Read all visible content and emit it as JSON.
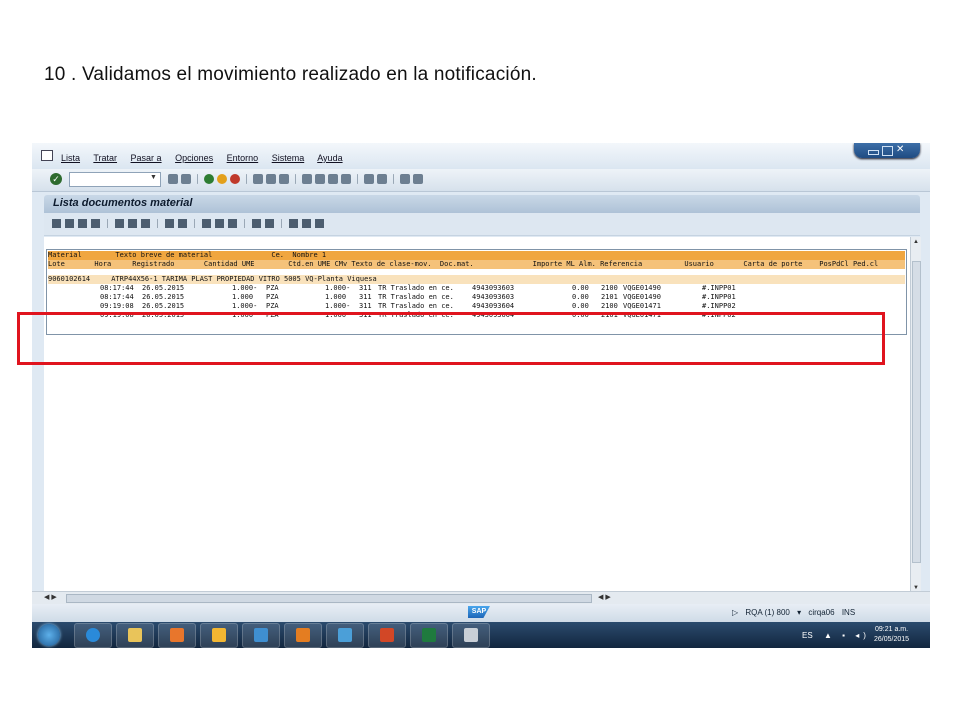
{
  "caption": "10 . Validamos el movimiento realizado en la notificación.",
  "menu": [
    "Lista",
    "Tratar",
    "Pasar a",
    "Opciones",
    "Entorno",
    "Sistema",
    "Ayuda"
  ],
  "window_title": "Lista documentos material",
  "list": {
    "header1": "Material        Texto breve de material              Ce.  Nombre 1",
    "header2": "Lote       Hora     Registrado       Cantidad UME        Ctd.en UME CMv Texto de clase-mov.  Doc.mat.              Importe ML Alm. Referencia          Usuario       Carta de porte    PosPdCl Ped.cl",
    "material_row": "9060102614     ATRP44X56-1 TARIMA PLAST PROPIEDAD VITRO 5005 VQ-Planta Viquesa",
    "rows": [
      {
        "hora": "08:17:44",
        "fecha": "26.05.2015",
        "cant": "1.000-",
        "ume": "PZA",
        "ctd": "1.000-",
        "cmv": "311",
        "texto": "TR Traslado en ce.",
        "doc": "4943093603",
        "importe": "0.00",
        "alm": "2100",
        "ref": "VQGE01490",
        "usuario": "#.INPP01",
        "neg": true
      },
      {
        "hora": "08:17:44",
        "fecha": "26.05.2015",
        "cant": "1.000",
        "ume": "PZA",
        "ctd": "1.000",
        "cmv": "311",
        "texto": "TR Traslado en ce.",
        "doc": "4943093603",
        "importe": "0.00",
        "alm": "2101",
        "ref": "VQGE01490",
        "usuario": "#.INPP01",
        "neg": false
      },
      {
        "hora": "09:19:08",
        "fecha": "26.05.2015",
        "cant": "1.000-",
        "ume": "PZA",
        "ctd": "1.000-",
        "cmv": "311",
        "texto": "TR Traslado en ce.",
        "doc": "4943093604",
        "importe": "0.00",
        "alm": "2100",
        "ref": "VQGE01471",
        "usuario": "#.INPP02",
        "neg": true
      },
      {
        "hora": "09:19:08",
        "fecha": "26.05.2015",
        "cant": "1.000",
        "ume": "PZA",
        "ctd": "1.000",
        "cmv": "311",
        "texto": "TR Traslado en ce.",
        "doc": "4943093604",
        "importe": "0.00",
        "alm": "2101",
        "ref": "VQGE01471",
        "usuario": "#.INPP02",
        "neg": false
      }
    ]
  },
  "status": {
    "system": "RQA (1) 800",
    "server": "cirqa06",
    "mode": "INS",
    "sap_logo": "SAP"
  },
  "taskbar": {
    "lang": "ES",
    "time": "09:21 a.m.",
    "date": "26/05/2015"
  },
  "colors": {
    "negative": "#f28b8b",
    "positive": "#a4e79a",
    "highlight": "#e0141e"
  }
}
